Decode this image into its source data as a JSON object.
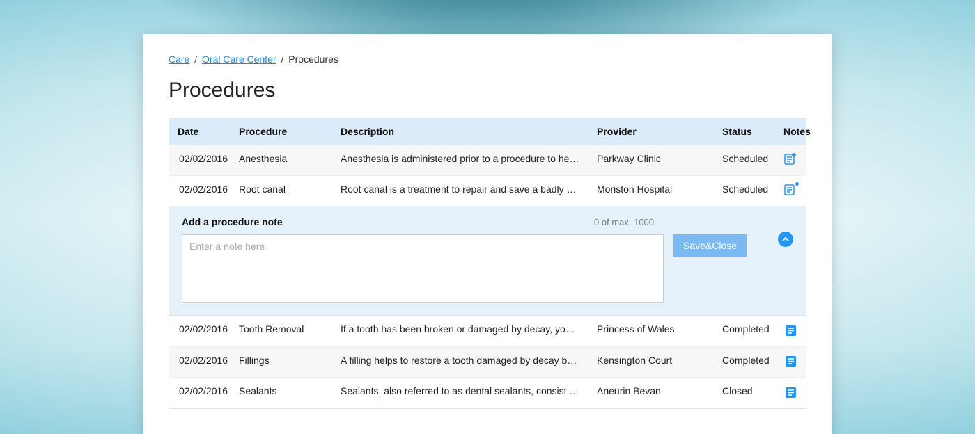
{
  "breadcrumb": {
    "items": [
      {
        "label": "Care",
        "link": true
      },
      {
        "label": "Oral Care Center",
        "link": true
      },
      {
        "label": "Procedures",
        "link": false
      }
    ]
  },
  "page_title": "Procedures",
  "columns": {
    "date": "Date",
    "procedure": "Procedure",
    "description": "Description",
    "provider": "Provider",
    "status": "Status",
    "notes": "Notes"
  },
  "rows": [
    {
      "date": "02/02/2016",
      "procedure": "Anesthesia",
      "description": "Anesthesia is administered prior to a procedure to help dull...",
      "provider": "Parkway Clinic",
      "status": "Scheduled",
      "note_icon": "add"
    },
    {
      "date": "02/02/2016",
      "procedure": "Root canal",
      "description": "Root canal is a treatment to repair and save a badly damag....",
      "provider": "Moriston Hospital",
      "status": "Scheduled",
      "note_icon": "add-dot"
    },
    {
      "date": "02/02/2016",
      "procedure": "Tooth Removal",
      "description": "If a tooth has been broken or damaged by decay, your dent...",
      "provider": "Princess of Wales",
      "status": "Completed",
      "note_icon": "filled"
    },
    {
      "date": "02/02/2016",
      "procedure": "Fillings",
      "description": "A filling helps to restore a tooth damaged by decay back to ...",
      "provider": "Kensington Court",
      "status": "Completed",
      "note_icon": "filled"
    },
    {
      "date": "02/02/2016",
      "procedure": "Sealants",
      "description": "Sealants, also referred to as dental sealants, consist of a plas...",
      "provider": "Aneurin Bevan",
      "status": "Closed",
      "note_icon": "filled"
    }
  ],
  "note_panel": {
    "title": "Add a procedure note",
    "counter": "0 of max. 1000",
    "placeholder": "Enter a note here",
    "save_label": "Save&Close"
  }
}
